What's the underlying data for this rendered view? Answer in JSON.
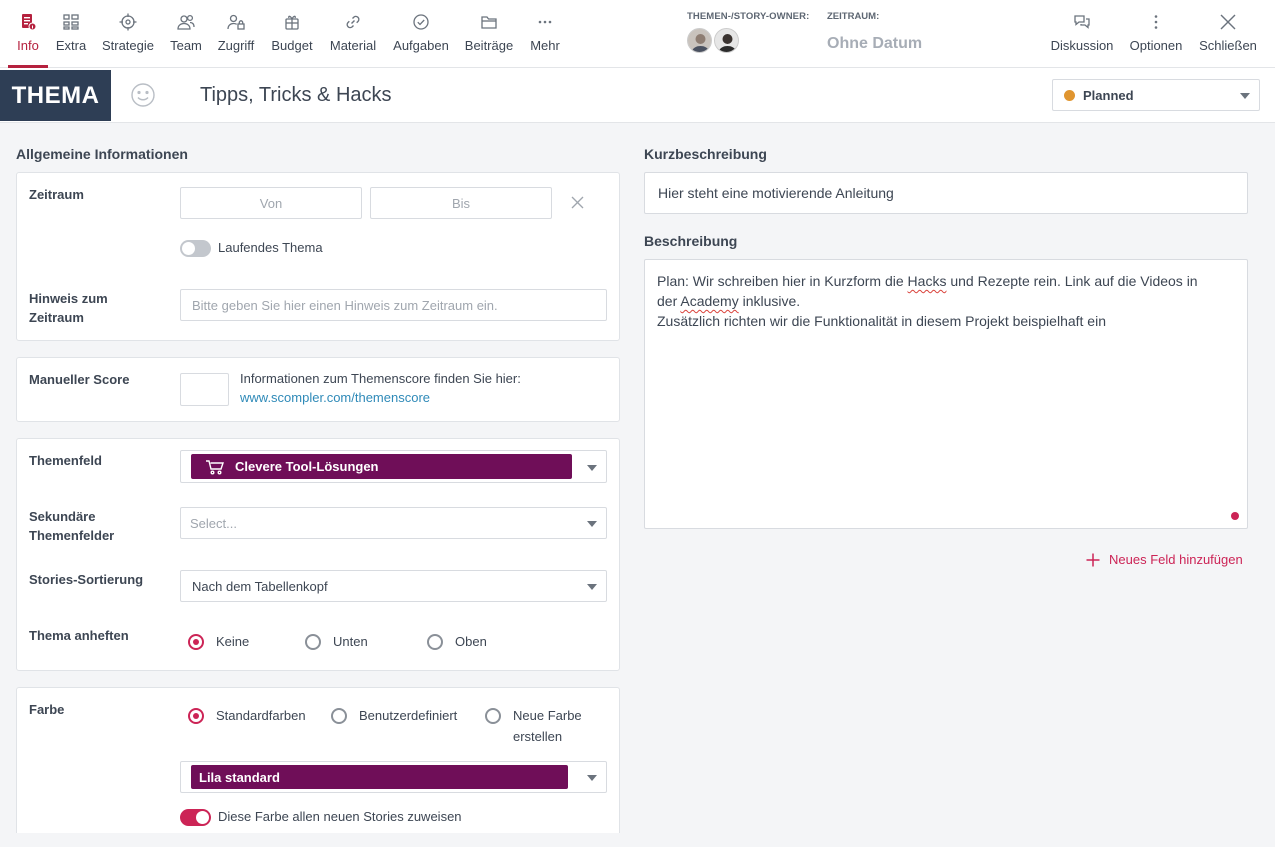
{
  "nav": {
    "items": [
      {
        "label": "Info",
        "icon": "info-document-icon"
      },
      {
        "label": "Extra",
        "icon": "grid-list-icon"
      },
      {
        "label": "Strategie",
        "icon": "target-icon"
      },
      {
        "label": "Team",
        "icon": "team-icon"
      },
      {
        "label": "Zugriff",
        "icon": "user-lock-icon"
      },
      {
        "label": "Budget",
        "icon": "gift-icon"
      },
      {
        "label": "Material",
        "icon": "link-icon"
      },
      {
        "label": "Aufgaben",
        "icon": "check-circle-icon"
      },
      {
        "label": "Beiträge",
        "icon": "folder-icon"
      },
      {
        "label": "Mehr",
        "icon": "more-dots-icon"
      }
    ],
    "active": "Info",
    "right": [
      {
        "label": "Diskussion",
        "icon": "chat-bubbles-icon"
      },
      {
        "label": "Optionen",
        "icon": "vertical-dots-icon"
      },
      {
        "label": "Schließen",
        "icon": "close-icon"
      }
    ]
  },
  "header": {
    "owner_label": "THEMEN-/STORY-OWNER:",
    "zeitraum_label": "ZEITRAUM:",
    "zeitraum_value": "Ohne Datum"
  },
  "title_bar": {
    "badge": "THEMA",
    "title": "Tipps, Tricks & Hacks",
    "status": "Planned",
    "status_color": "#e0952f"
  },
  "left": {
    "section_title": "Allgemeine Informationen",
    "zeitraum": {
      "label": "Zeitraum",
      "von_placeholder": "Von",
      "bis_placeholder": "Bis",
      "laufend_label": "Laufendes Thema"
    },
    "hinweis": {
      "label_line1": "Hinweis zum",
      "label_line2": "Zeitraum",
      "placeholder": "Bitte geben Sie hier einen Hinweis zum Zeitraum ein."
    },
    "score": {
      "label": "Manueller Score",
      "info": "Informationen zum Themenscore finden Sie hier:",
      "link": "www.scompler.com/themenscore"
    },
    "themenfeld": {
      "label": "Themenfeld",
      "value": "Clevere Tool-Lösungen",
      "pill_color": "#6f0e58"
    },
    "sekundaer": {
      "label_line1": "Sekundäre",
      "label_line2": "Themenfelder",
      "placeholder": "Select..."
    },
    "sortierung": {
      "label": "Stories-Sortierung",
      "value": "Nach dem Tabellenkopf"
    },
    "anheften": {
      "label": "Thema anheften",
      "options": [
        "Keine",
        "Unten",
        "Oben"
      ],
      "selected": "Keine"
    },
    "farbe": {
      "label": "Farbe",
      "options": [
        "Standardfarben",
        "Benutzerdefiniert",
        "Neue Farbe",
        "erstellen"
      ],
      "selected": "Standardfarben",
      "value": "Lila standard",
      "assign_label": "Diese Farbe allen neuen Stories zuweisen"
    }
  },
  "right": {
    "kurz_title": "Kurzbeschreibung",
    "kurz_value": "Hier steht eine motivierende Anleitung",
    "beschreibung_title": "Beschreibung",
    "beschreibung": {
      "l1a": "Plan: Wir schreiben hier in Kurzform die ",
      "l1b": "Hacks",
      "l1c": " und Rezepte rein. Link auf die Videos in",
      "l2a": "der ",
      "l2b": "Academy",
      "l2c": " inklusive.",
      "l3": "Zusätzlich richten wir die Funktionalität in diesem Projekt beispielhaft ein"
    },
    "add_field": "Neues Feld hinzufügen"
  }
}
